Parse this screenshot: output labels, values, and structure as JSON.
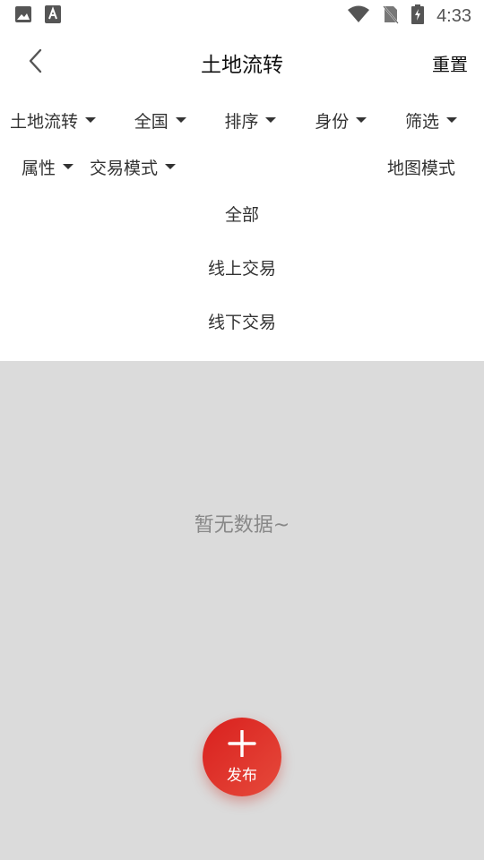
{
  "status_bar": {
    "time": "4:33",
    "left_icons": [
      "image-icon",
      "a-text-icon"
    ],
    "right_icons": [
      "wifi-icon",
      "no-sim-icon",
      "battery-charging-icon"
    ]
  },
  "app_bar": {
    "title": "土地流转",
    "reset_label": "重置",
    "back_icon": "chevron-left-icon"
  },
  "filters_row1": [
    {
      "label": "土地流转"
    },
    {
      "label": "全国"
    },
    {
      "label": "排序"
    },
    {
      "label": "身份"
    },
    {
      "label": "筛选"
    }
  ],
  "filters_row2": [
    {
      "label": "属性"
    },
    {
      "label": "交易模式"
    }
  ],
  "map_mode_label": "地图模式",
  "dropdown_options": [
    "全部",
    "线上交易",
    "线下交易"
  ],
  "empty_state": {
    "text": "暂无数据~"
  },
  "fab": {
    "label": "发布",
    "icon": "plus-icon"
  },
  "colors": {
    "accent": "#d9201e",
    "overlay_bg": "#dbdbdb",
    "text_primary": "#111111",
    "text_secondary": "#333333",
    "muted_text": "#888888"
  }
}
